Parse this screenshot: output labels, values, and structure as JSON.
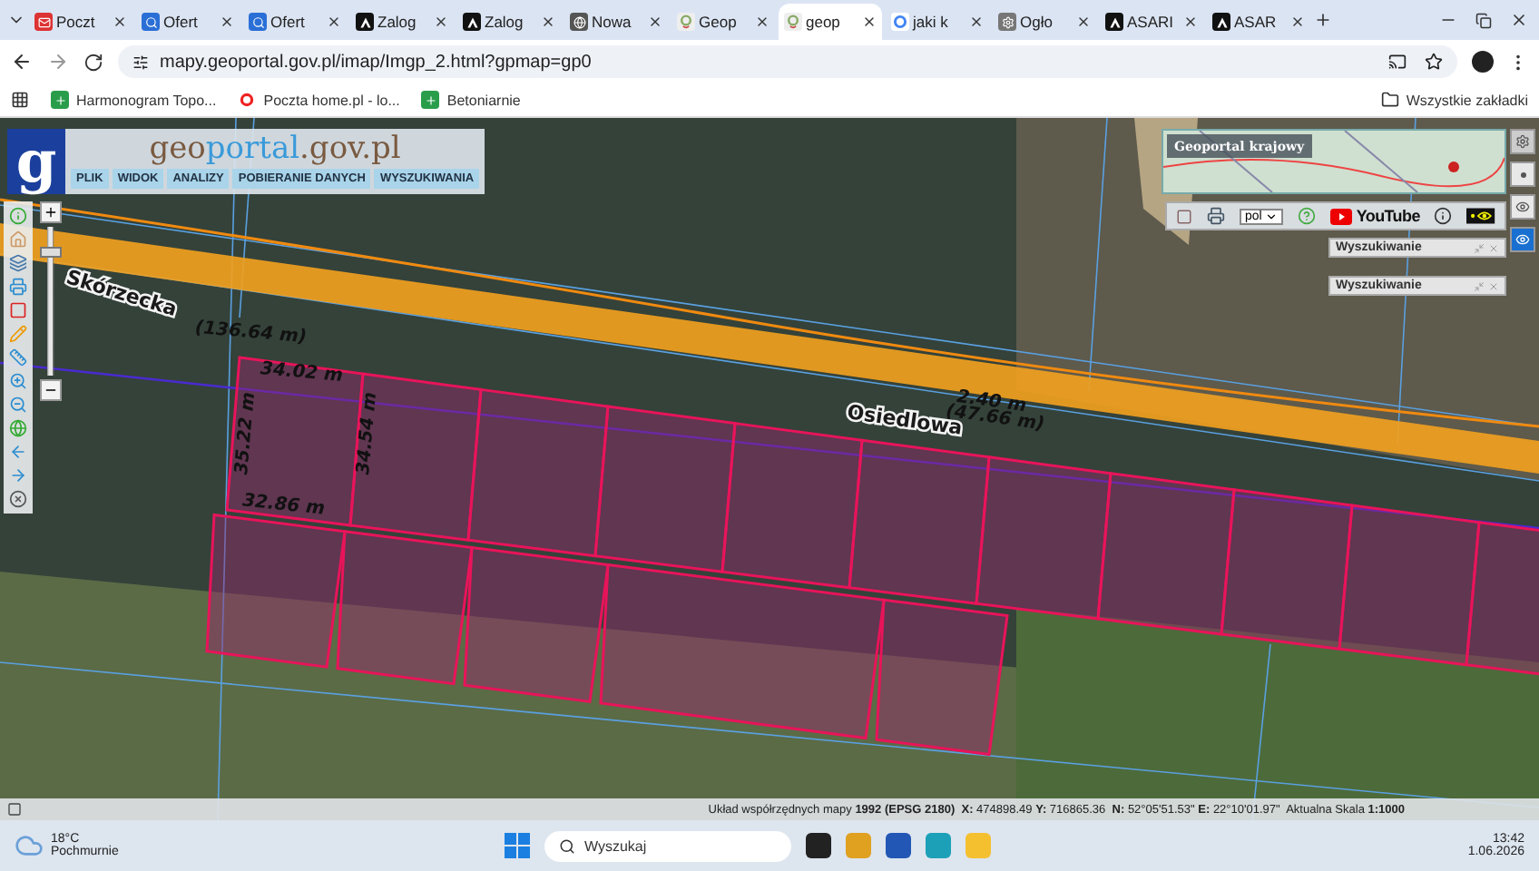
{
  "browser": {
    "tabs": [
      {
        "title": "Poczt",
        "kind": "mail",
        "selected": false
      },
      {
        "title": "Ofert",
        "kind": "search",
        "selected": false
      },
      {
        "title": "Ofert",
        "kind": "search",
        "selected": false
      },
      {
        "title": "Zalog",
        "kind": "letter",
        "selected": false
      },
      {
        "title": "Zalog",
        "kind": "letter",
        "selected": false
      },
      {
        "title": "Nowa",
        "kind": "globe",
        "selected": false
      },
      {
        "title": "Geop",
        "kind": "geo",
        "selected": false
      },
      {
        "title": "geop",
        "kind": "geo",
        "selected": true
      },
      {
        "title": "jaki k",
        "kind": "google",
        "selected": false
      },
      {
        "title": "Ogło",
        "kind": "gear",
        "selected": false
      },
      {
        "title": "ASARI",
        "kind": "letter",
        "selected": false
      },
      {
        "title": "ASAR",
        "kind": "letter",
        "selected": false
      }
    ],
    "address": "mapy.geoportal.gov.pl/imap/Imgp_2.html?gpmap=gp0",
    "bookmarks": [
      {
        "title": "Harmonogram Topo...",
        "kind": "sheet"
      },
      {
        "title": "Poczta home.pl - lo...",
        "kind": "mail"
      },
      {
        "title": "Betoniarnie",
        "kind": "sheet"
      }
    ],
    "all_bookmarks": "Wszystkie zakładki"
  },
  "geoportal": {
    "logo_letter": "g",
    "logo": {
      "prefix": "geo",
      "middle": "portal",
      "suffix": ".gov.pl"
    },
    "menu": [
      "PLIK",
      "WIDOK",
      "ANALIZY",
      "POBIERANIE DANYCH",
      "WYSZUKIWANIA"
    ],
    "zoom": {
      "level": 0.85
    },
    "overview_title": "Geoportal krajowy",
    "language": "pol",
    "youtube": "YouTube",
    "search_panels": [
      "Wyszukiwanie",
      "Wyszukiwanie"
    ],
    "map_labels": [
      {
        "text": "Skórzecka",
        "kind": "street"
      },
      {
        "text": "(136.64 m)",
        "kind": "measure"
      },
      {
        "text": "34.02 m",
        "kind": "measure"
      },
      {
        "text": "35.22 m",
        "kind": "measure"
      },
      {
        "text": "34.54 m",
        "kind": "measure"
      },
      {
        "text": "32.86 m",
        "kind": "measure"
      },
      {
        "text": "2.40 m",
        "kind": "measure"
      },
      {
        "text": "(47.66 m)",
        "kind": "measure"
      },
      {
        "text": "Osiedlowa",
        "kind": "street"
      }
    ],
    "status": "Układ współrzędnych mapy **1992 (EPSG 2180)**  **X:** 474898.49 **Y:** 716865.36  **N:** 52°05'51.53\" **E:** 22°10'01.97\"  Aktualna Skala **1:1000**"
  },
  "taskbar": {
    "temperature": "18°C",
    "weather": "Pochmurnie",
    "search_placeholder": "Wyszukaj",
    "time": "13:42",
    "date": "1.06.2026"
  }
}
